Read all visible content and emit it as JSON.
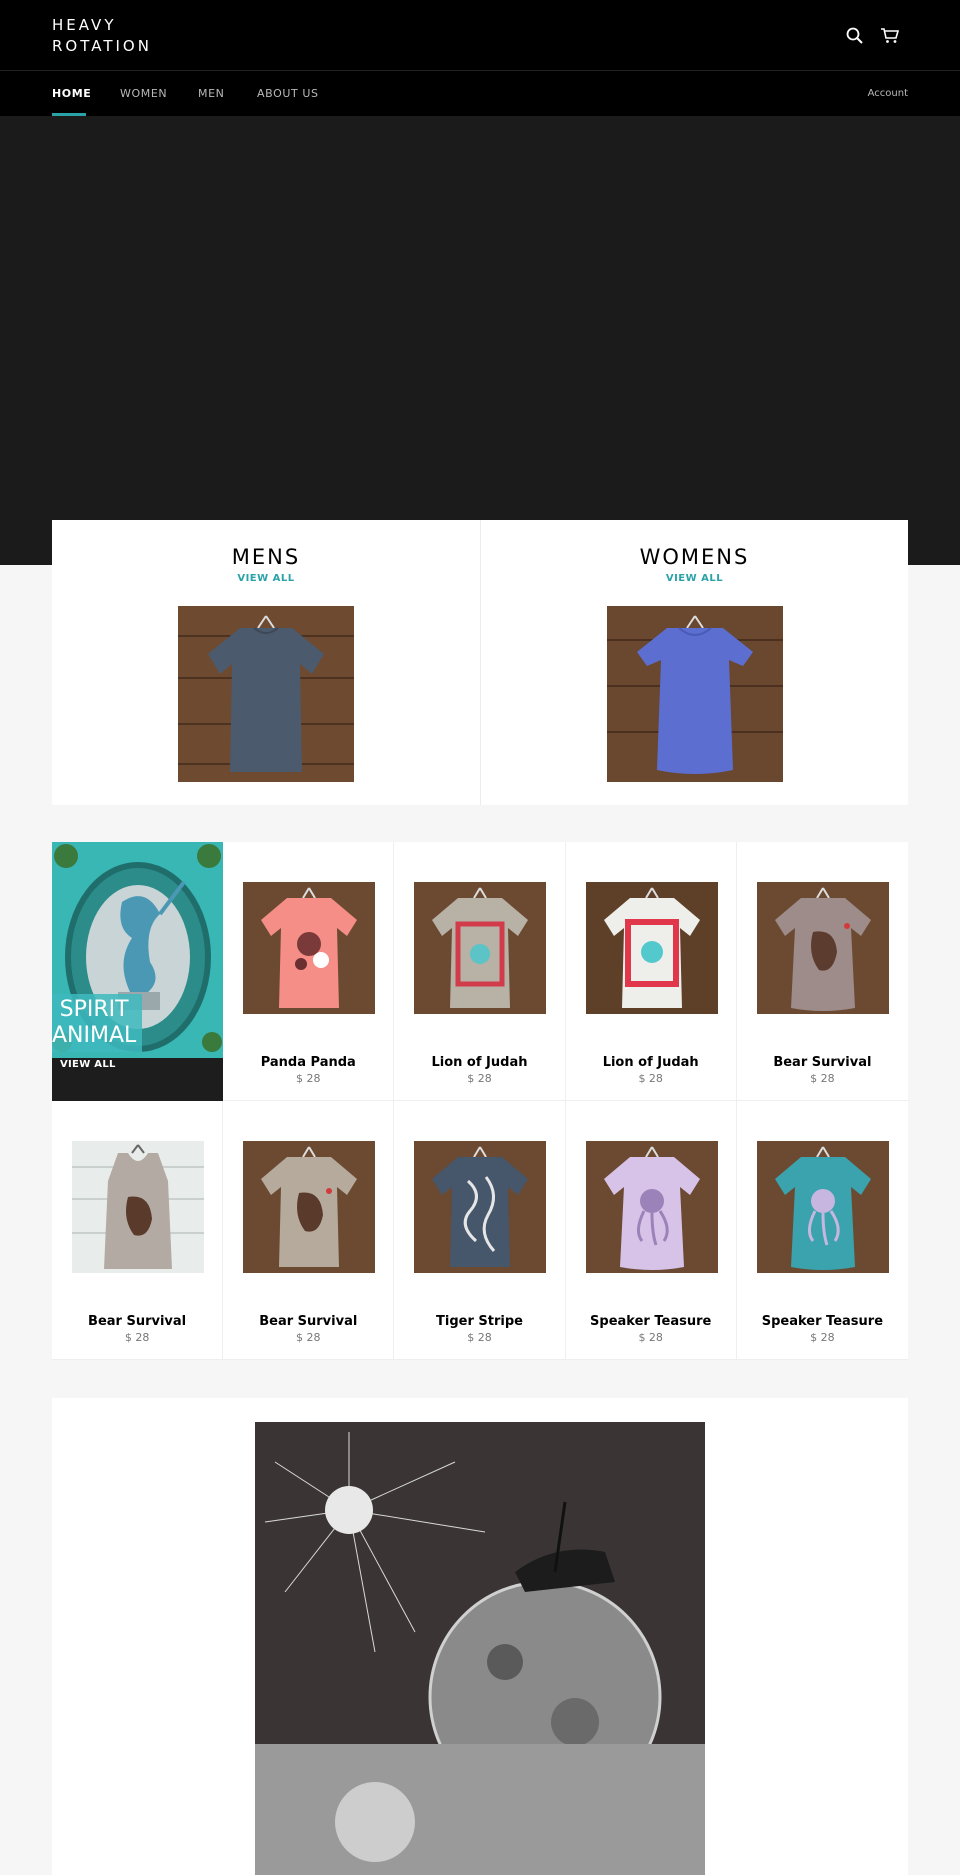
{
  "header": {
    "logo_line1": "HEAVY",
    "logo_line2": "ROTATION",
    "icons": [
      "search-icon",
      "cart-icon"
    ]
  },
  "nav": {
    "items": [
      {
        "label": "HOME",
        "active": true
      },
      {
        "label": "WOMEN"
      },
      {
        "label": "MEN"
      },
      {
        "label": "ABOUT US"
      }
    ],
    "account": "Account"
  },
  "collections": [
    {
      "title": "MENS",
      "link": "VIEW ALL"
    },
    {
      "title": "WOMENS",
      "link": "VIEW ALL"
    }
  ],
  "featured_collection": {
    "title_line1": "SPIRIT",
    "title_line2": "ANIMAL",
    "link": "VIEW ALL"
  },
  "products": [
    {
      "name": "Panda Panda",
      "price": "$ 28"
    },
    {
      "name": "Lion of Judah",
      "price": "$ 28"
    },
    {
      "name": "Lion of Judah",
      "price": "$ 28"
    },
    {
      "name": "Bear Survival",
      "price": "$ 28"
    },
    {
      "name": "Bear Survival",
      "price": "$ 28"
    },
    {
      "name": "Bear Survival",
      "price": "$ 28"
    },
    {
      "name": "Tiger Stripe",
      "price": "$ 28"
    },
    {
      "name": "Speaker Teasure",
      "price": "$ 28"
    },
    {
      "name": "Speaker Teasure",
      "price": "$ 28"
    }
  ],
  "colors": {
    "accent": "#2aa3a8",
    "header_bg": "#000000",
    "hero_bg": "#1b1b1b",
    "page_bg": "#f6f6f6"
  }
}
